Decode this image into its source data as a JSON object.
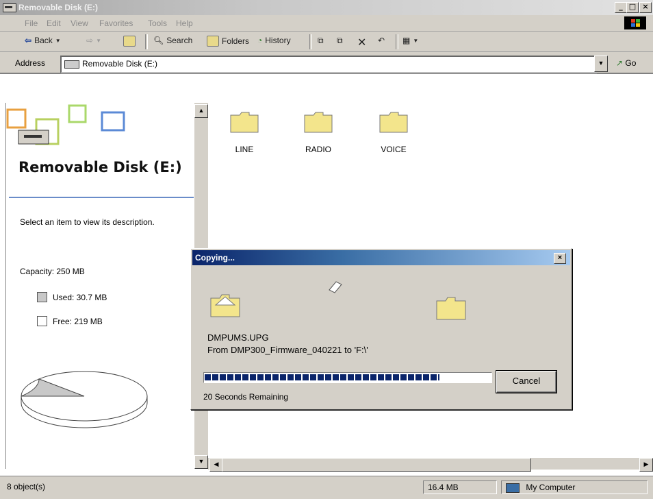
{
  "window": {
    "title": "Removable Disk (E:)"
  },
  "menu": [
    "File",
    "Edit",
    "View",
    "Favorites",
    "Tools",
    "Help"
  ],
  "toolbar": {
    "back": "Back",
    "search": "Search",
    "folders": "Folders",
    "history": "History"
  },
  "address": {
    "label": "Address",
    "value": "Removable Disk (E:)",
    "go": "Go"
  },
  "left_pane": {
    "title": "Removable Disk (E:)",
    "description": "Select an item to view its description.",
    "capacity": "Capacity: 250 MB",
    "used": "Used: 30.7 MB",
    "free": "Free: 219 MB",
    "used_fraction": 0.123
  },
  "folders": [
    {
      "name": "LINE"
    },
    {
      "name": "RADIO"
    },
    {
      "name": "VOICE"
    }
  ],
  "dialog": {
    "title": "Copying...",
    "filename": "DMPUMS.UPG",
    "from_text": "From DMP300_Firmware_040221  to  'F:\\'",
    "progress_fraction": 0.82,
    "cancel": "Cancel",
    "remaining": "20 Seconds Remaining"
  },
  "status": {
    "objects": "8 object(s)",
    "size": "16.4 MB",
    "location": "My Computer"
  },
  "colors": {
    "dialog_title_start": "#0a246a",
    "dialog_title_end": "#a6caf0",
    "progress": "#0a246a",
    "folder": "#f3e58c"
  }
}
